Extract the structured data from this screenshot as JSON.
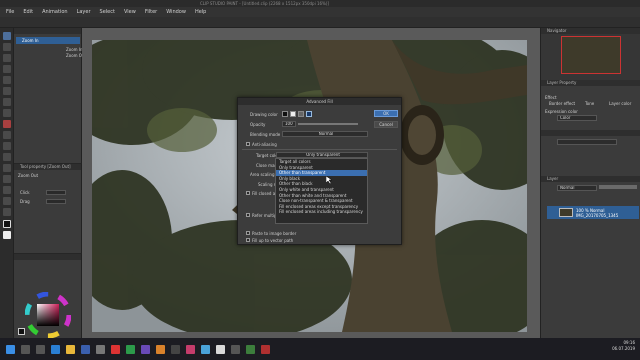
{
  "window": {
    "title": "CLIP STUDIO PAINT - [Untitled.clip (2268 x 1512px 350dpi 16%)]"
  },
  "menu": [
    "File",
    "Edit",
    "Animation",
    "Layer",
    "Select",
    "View",
    "Filter",
    "Window",
    "Help"
  ],
  "subtool_panel": {
    "items": [
      "Zoom In",
      "Zoom Out"
    ]
  },
  "tool_property": {
    "title": "Tool property [Zoom Out]",
    "tool_name": "Zoom Out",
    "rows": [
      "Click",
      "Drag"
    ]
  },
  "navigator": {
    "title": "Navigator"
  },
  "layer_property": {
    "title": "Layer Property",
    "effect_label": "Effect",
    "items": [
      "Border effect",
      "Tone",
      "Layer color"
    ],
    "expression_label": "Expression color",
    "expression_value": "Color"
  },
  "layer_panel": {
    "title": "Layer",
    "blend": "Normal",
    "layer_name": "100 % Normal",
    "layer_subname": "IMG_20170705_1345"
  },
  "dialog": {
    "title": "Advanced Fill",
    "drawing_color_label": "Drawing color",
    "opacity_label": "Opacity",
    "opacity_value": "100",
    "blending_label": "Blending mode",
    "blending_value": "Normal",
    "antialias_label": "Anti-aliasing",
    "target_color_label": "Target color",
    "target_color_value": "Only transparent",
    "close_gaps_label": "Close margin",
    "area_scaling_label": "Area scaling",
    "scaling_mode_label": "Scaling mode",
    "fill_mode_label": "Fill closed area",
    "refer_multiple_label": "Refer multiple",
    "paste_label": "Paste to image border",
    "fill_vector_label": "Fill up to vector path",
    "ok_label": "OK",
    "cancel_label": "Cancel"
  },
  "dropdown_options": [
    "Target all colors",
    "Only transparent",
    "Other than transparent",
    "Only black",
    "Other than black",
    "Only white and transparent",
    "Other than white and transparent",
    "Close non-transparent & transparent",
    "Fill enclosed areas except transparency",
    "Fill enclosed areas including transparency"
  ],
  "dropdown_highlighted": 2,
  "taskbar": {
    "time": "09:16",
    "date": "06.07.2019"
  },
  "colors": {
    "accent": "#3b6fb1",
    "selection": "#2f5f95",
    "panel": "#3b3b3b"
  }
}
